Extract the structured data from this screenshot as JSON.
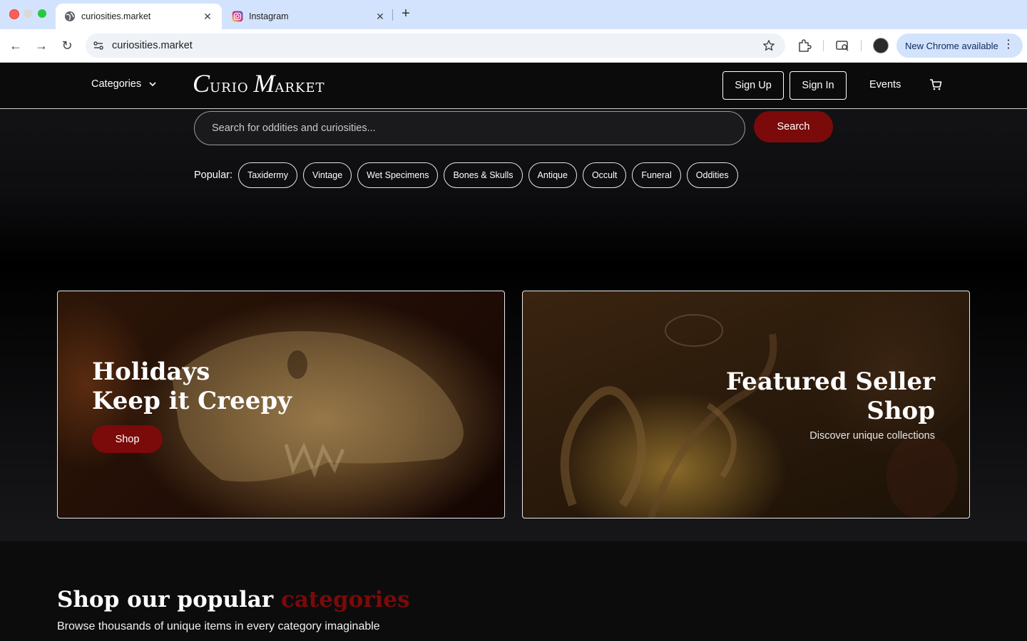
{
  "browser": {
    "tabs": [
      {
        "title": "curiosities.market",
        "active": true,
        "icon": "globe-icon"
      },
      {
        "title": "Instagram",
        "active": false,
        "icon": "instagram-icon"
      }
    ],
    "address": "curiosities.market",
    "update_label": "New Chrome available"
  },
  "header": {
    "categories_label": "Categories",
    "logo": {
      "c": "C",
      "urio": "URIO",
      "m": "M",
      "arket": "ARKET"
    },
    "sign_up": "Sign Up",
    "sign_in": "Sign In",
    "events": "Events"
  },
  "search": {
    "placeholder": "Search for oddities and curiosities...",
    "button": "Search"
  },
  "popular": {
    "label": "Popular:",
    "tags": [
      "Taxidermy",
      "Vintage",
      "Wet Specimens",
      "Bones & Skulls",
      "Antique",
      "Occult",
      "Funeral",
      "Oddities"
    ]
  },
  "promos": {
    "left": {
      "line1": "Holidays",
      "line2": "Keep it Creepy",
      "button": "Shop"
    },
    "right": {
      "line1": "Featured Seller",
      "line2": "Shop",
      "subtitle": "Discover unique collections"
    }
  },
  "categories_section": {
    "heading": "Shop our popular ",
    "heading_accent": "categories",
    "subtitle": "Browse thousands of unique items in every category imaginable"
  },
  "colors": {
    "brand_red": "#7b0a0a",
    "tabstrip": "#d3e3fd",
    "page_bg": "#0c0c0d"
  }
}
